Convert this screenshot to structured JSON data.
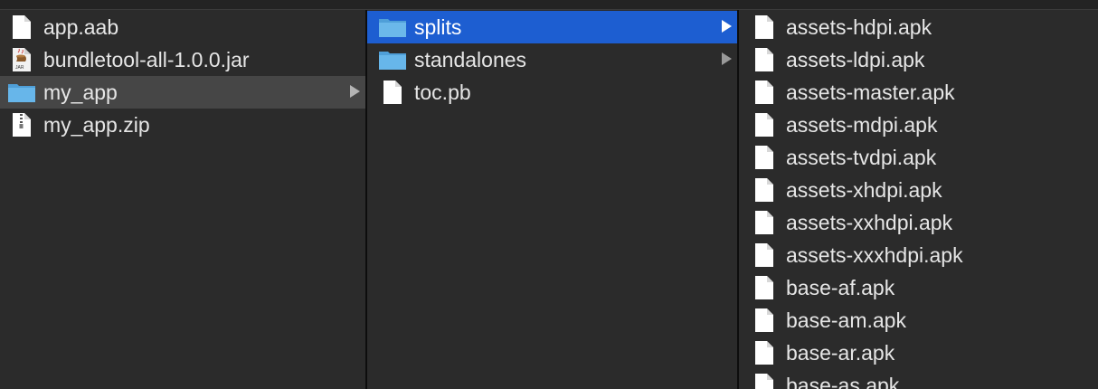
{
  "columns": [
    {
      "items": [
        {
          "label": "app.aab",
          "icon": "document-icon",
          "state": "normal",
          "has_children": false
        },
        {
          "label": "bundletool-all-1.0.0.jar",
          "icon": "jar-icon",
          "state": "normal",
          "has_children": false
        },
        {
          "label": "my_app",
          "icon": "folder-icon",
          "state": "selected-inactive",
          "has_children": true
        },
        {
          "label": "my_app.zip",
          "icon": "zip-icon",
          "state": "normal",
          "has_children": false
        }
      ]
    },
    {
      "items": [
        {
          "label": "splits",
          "icon": "folder-icon",
          "state": "selected-active",
          "has_children": true
        },
        {
          "label": "standalones",
          "icon": "folder-icon",
          "state": "normal",
          "has_children": true
        },
        {
          "label": "toc.pb",
          "icon": "document-icon",
          "state": "normal",
          "has_children": false
        }
      ]
    },
    {
      "items": [
        {
          "label": "assets-hdpi.apk",
          "icon": "document-icon"
        },
        {
          "label": "assets-ldpi.apk",
          "icon": "document-icon"
        },
        {
          "label": "assets-master.apk",
          "icon": "document-icon"
        },
        {
          "label": "assets-mdpi.apk",
          "icon": "document-icon"
        },
        {
          "label": "assets-tvdpi.apk",
          "icon": "document-icon"
        },
        {
          "label": "assets-xhdpi.apk",
          "icon": "document-icon"
        },
        {
          "label": "assets-xxhdpi.apk",
          "icon": "document-icon"
        },
        {
          "label": "assets-xxxhdpi.apk",
          "icon": "document-icon"
        },
        {
          "label": "base-af.apk",
          "icon": "document-icon"
        },
        {
          "label": "base-am.apk",
          "icon": "document-icon"
        },
        {
          "label": "base-ar.apk",
          "icon": "document-icon"
        },
        {
          "label": "base-as.apk",
          "icon": "document-icon"
        }
      ]
    }
  ],
  "colors": {
    "background": "#2b2b2b",
    "selection_active": "#1d5ed1",
    "selection_inactive": "#464646",
    "text": "#e6e6e6",
    "folder": "#5aaee4"
  }
}
